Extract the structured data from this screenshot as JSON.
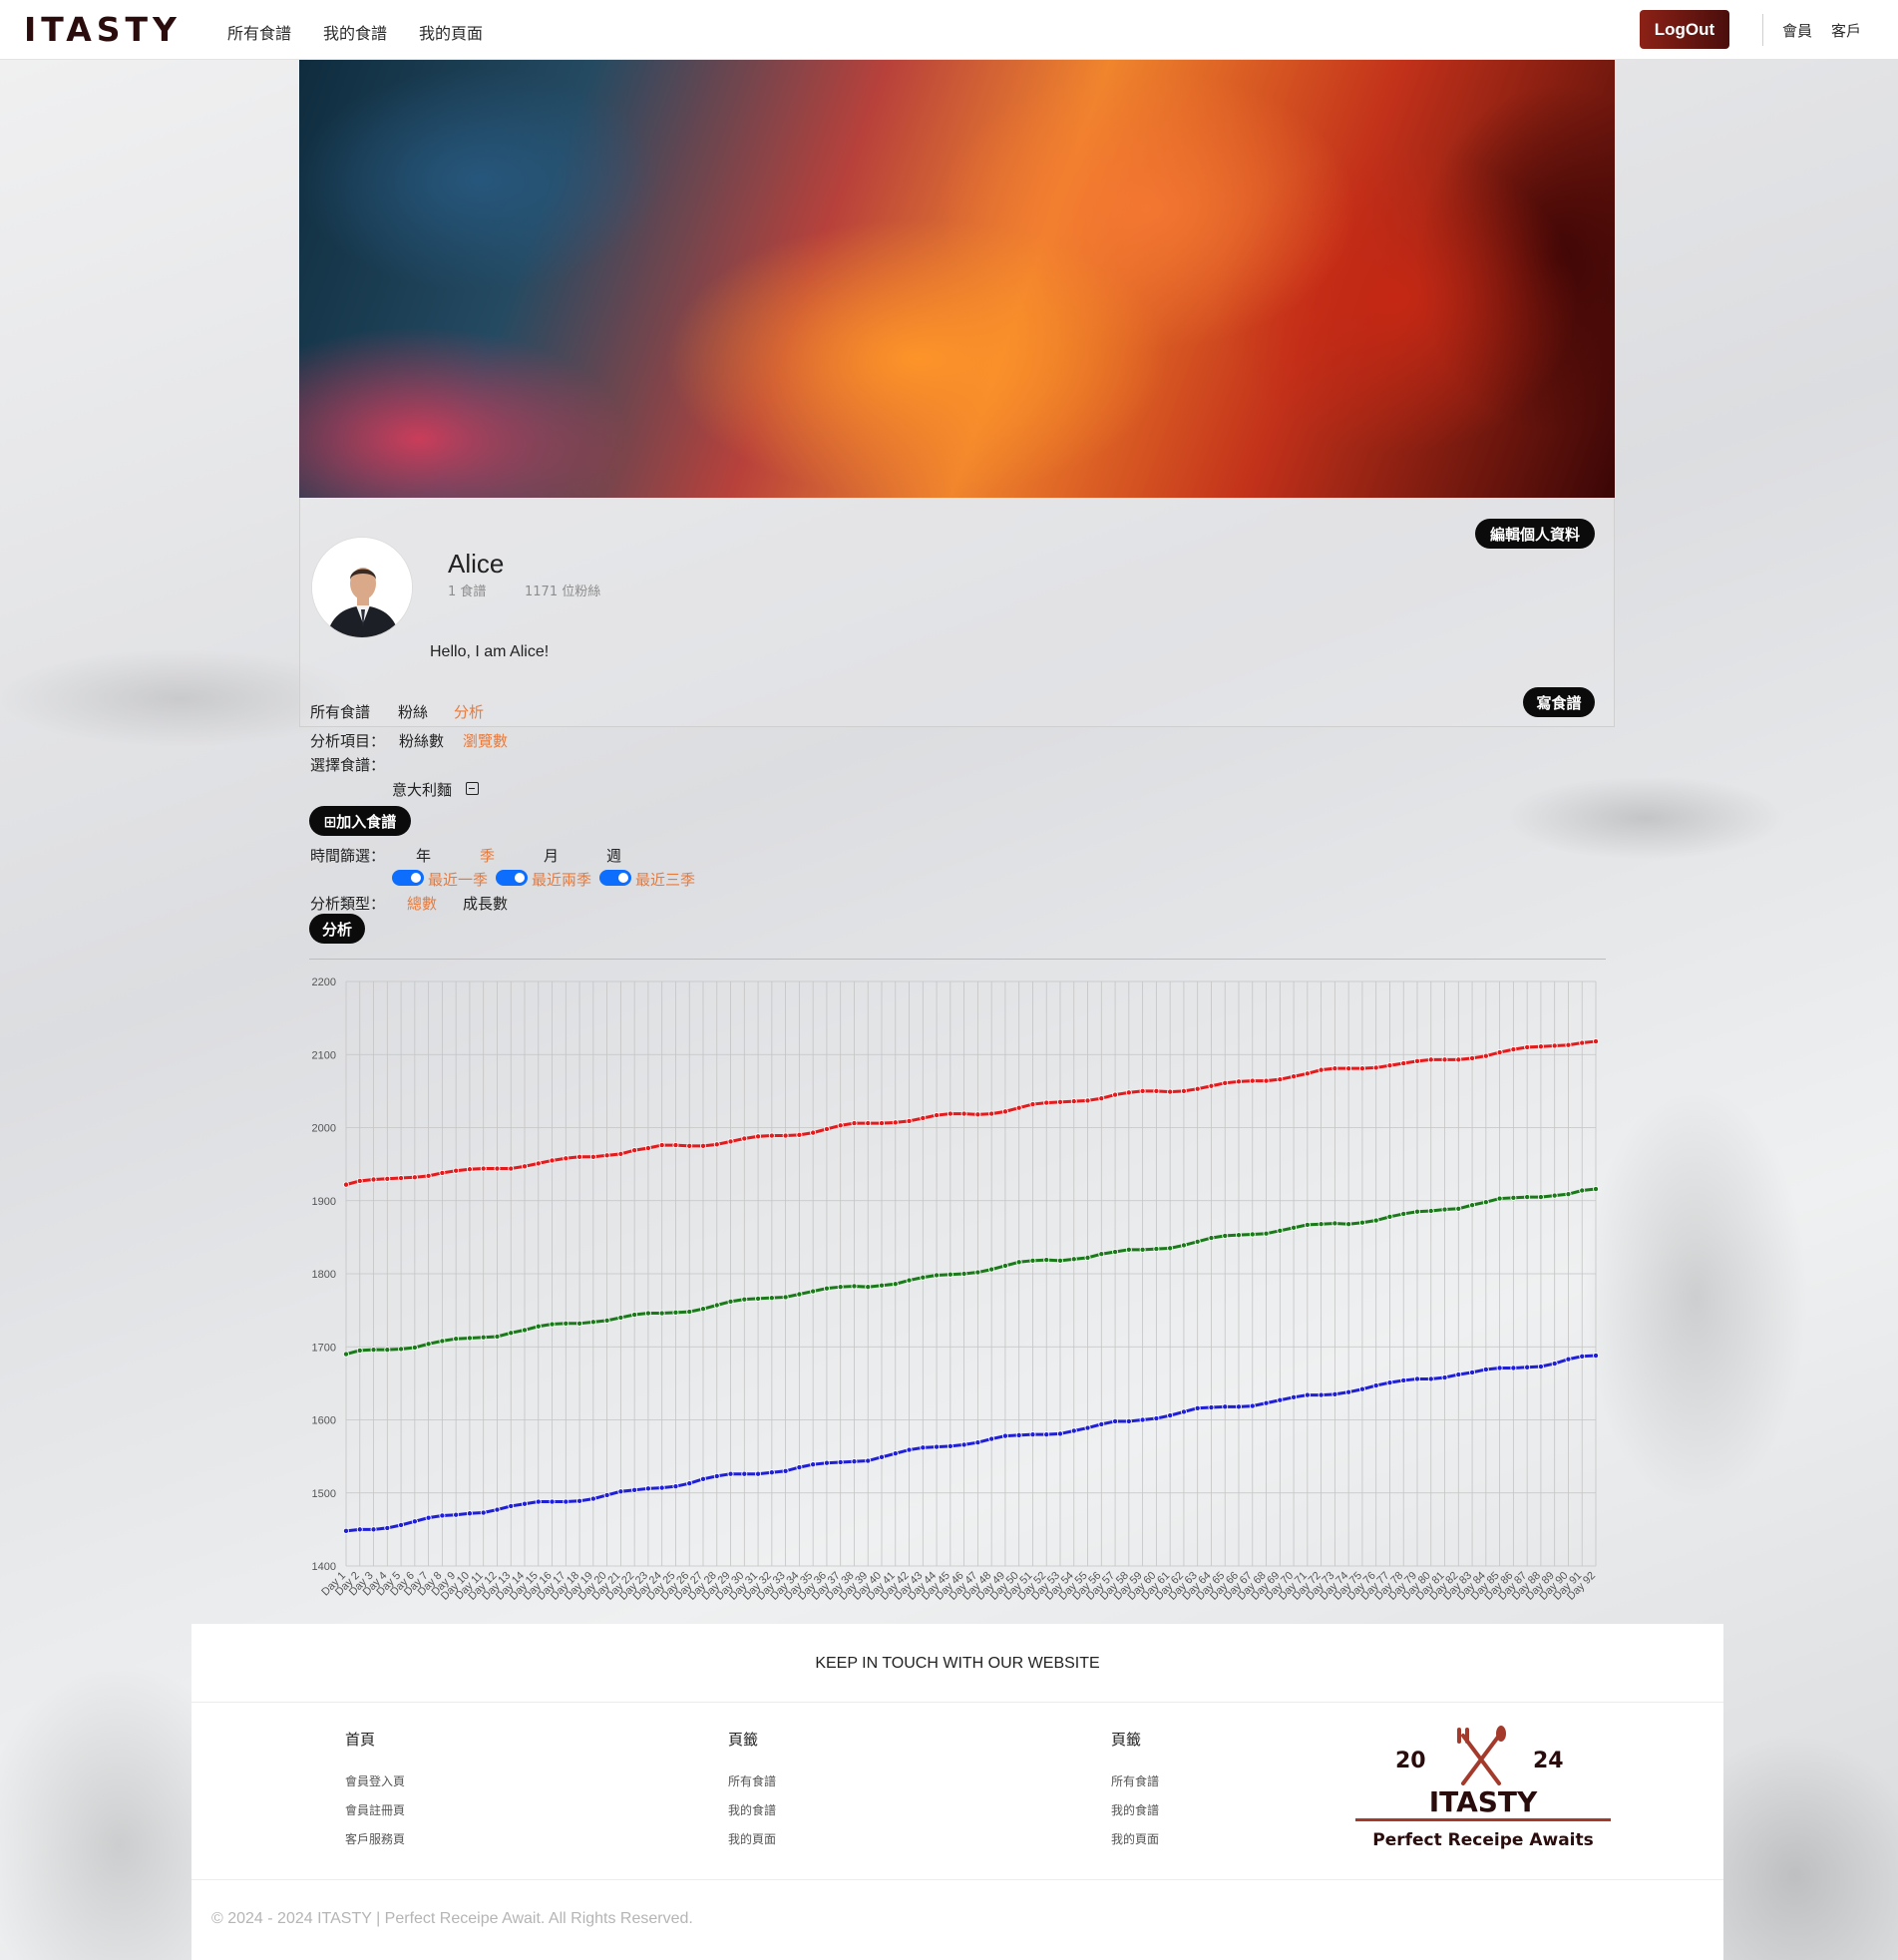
{
  "header": {
    "logo": "ITASTY",
    "nav": [
      "所有食譜",
      "我的食譜",
      "我的頁面"
    ],
    "logout": "LogOut",
    "right_links": [
      "會員",
      "客戶"
    ]
  },
  "profile": {
    "name": "Alice",
    "recipes": "1 食譜",
    "followers": "1171 位粉絲",
    "bio": "Hello, I am Alice!",
    "edit_button": "編輯個人資料",
    "write_button": "寫食譜",
    "tabs": [
      "所有食譜",
      "粉絲",
      "分析"
    ],
    "active_tab": 2
  },
  "analysis": {
    "item_label": "分析項目：",
    "item_options": [
      "粉絲數",
      "瀏覽數"
    ],
    "item_active": 1,
    "recipe_label": "選擇食譜：",
    "selected_recipe": "意大利麵",
    "add_recipe_button": "⊞加入食譜",
    "time_label": "時間篩選：",
    "time_options": [
      "年",
      "季",
      "月",
      "週"
    ],
    "time_active": 1,
    "ranges": [
      "最近一季",
      "最近兩季",
      "最近三季"
    ],
    "type_label": "分析類型：",
    "type_options": [
      "總數",
      "成長數"
    ],
    "type_active": 0,
    "analyze_button": "分析"
  },
  "chart_data": {
    "type": "line",
    "ylim": [
      1400,
      2200
    ],
    "yticks": [
      "2200",
      "2100",
      "2000",
      "1900",
      "1800",
      "1700",
      "1600",
      "1500",
      "1400"
    ],
    "x_count": 92,
    "x_prefix": "Day ",
    "grid": true,
    "series": [
      {
        "color": "#e41a1c",
        "start": 1922,
        "end": 2118
      },
      {
        "color": "#1a7a1a",
        "start": 1690,
        "end": 1916
      },
      {
        "color": "#1f1fd6",
        "start": 1448,
        "end": 1688
      }
    ]
  },
  "footer": {
    "title": "KEEP IN TOUCH WITH OUR WEBSITE",
    "cols": [
      {
        "head": "首頁",
        "items": [
          "會員登入頁",
          "會員註冊頁",
          "客戶服務頁"
        ]
      },
      {
        "head": "頁籤",
        "items": [
          "所有食譜",
          "我的食譜",
          "我的頁面"
        ]
      },
      {
        "head": "頁籤",
        "items": [
          "所有食譜",
          "我的食譜",
          "我的頁面"
        ]
      }
    ],
    "logo_year_left": "20",
    "logo_year_right": "24",
    "logo_name": "ITASTY",
    "logo_tagline": "Perfect Receipe Awaits",
    "copyright": "© 2024 - 2024 ITASTY | Perfect Receipe Await. All Rights Reserved."
  }
}
